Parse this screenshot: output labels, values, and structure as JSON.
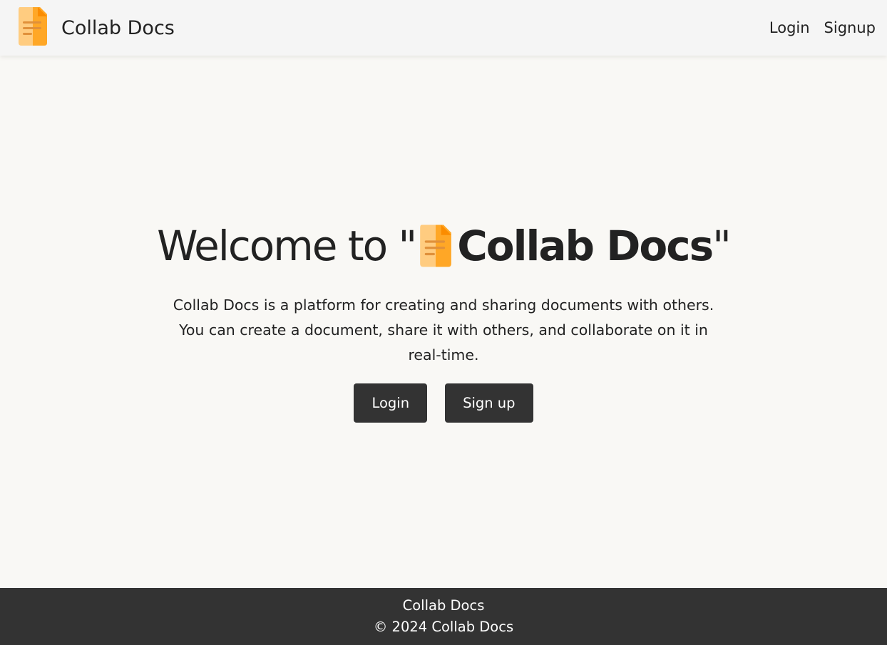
{
  "navbar": {
    "brand_name": "Collab Docs",
    "brand_icon": "document-icon",
    "links": {
      "login": "Login",
      "signup": "Signup"
    }
  },
  "hero": {
    "title_prefix": "Welcome to \"",
    "title_brand": "Collab Docs",
    "title_suffix": "\"",
    "description": "Collab Docs is a platform for creating and sharing documents with others. You can create a document, share it with others, and collaborate on it in real-time.",
    "buttons": {
      "login": "Login",
      "signup": "Sign up"
    }
  },
  "footer": {
    "title": "Collab Docs",
    "copyright": "© 2024 Collab Docs"
  },
  "colors": {
    "icon_light": "#ffcc80",
    "icon_dark": "#ffa726",
    "icon_fold": "#fb8c00",
    "button_bg": "#333333",
    "footer_bg": "#333333"
  }
}
